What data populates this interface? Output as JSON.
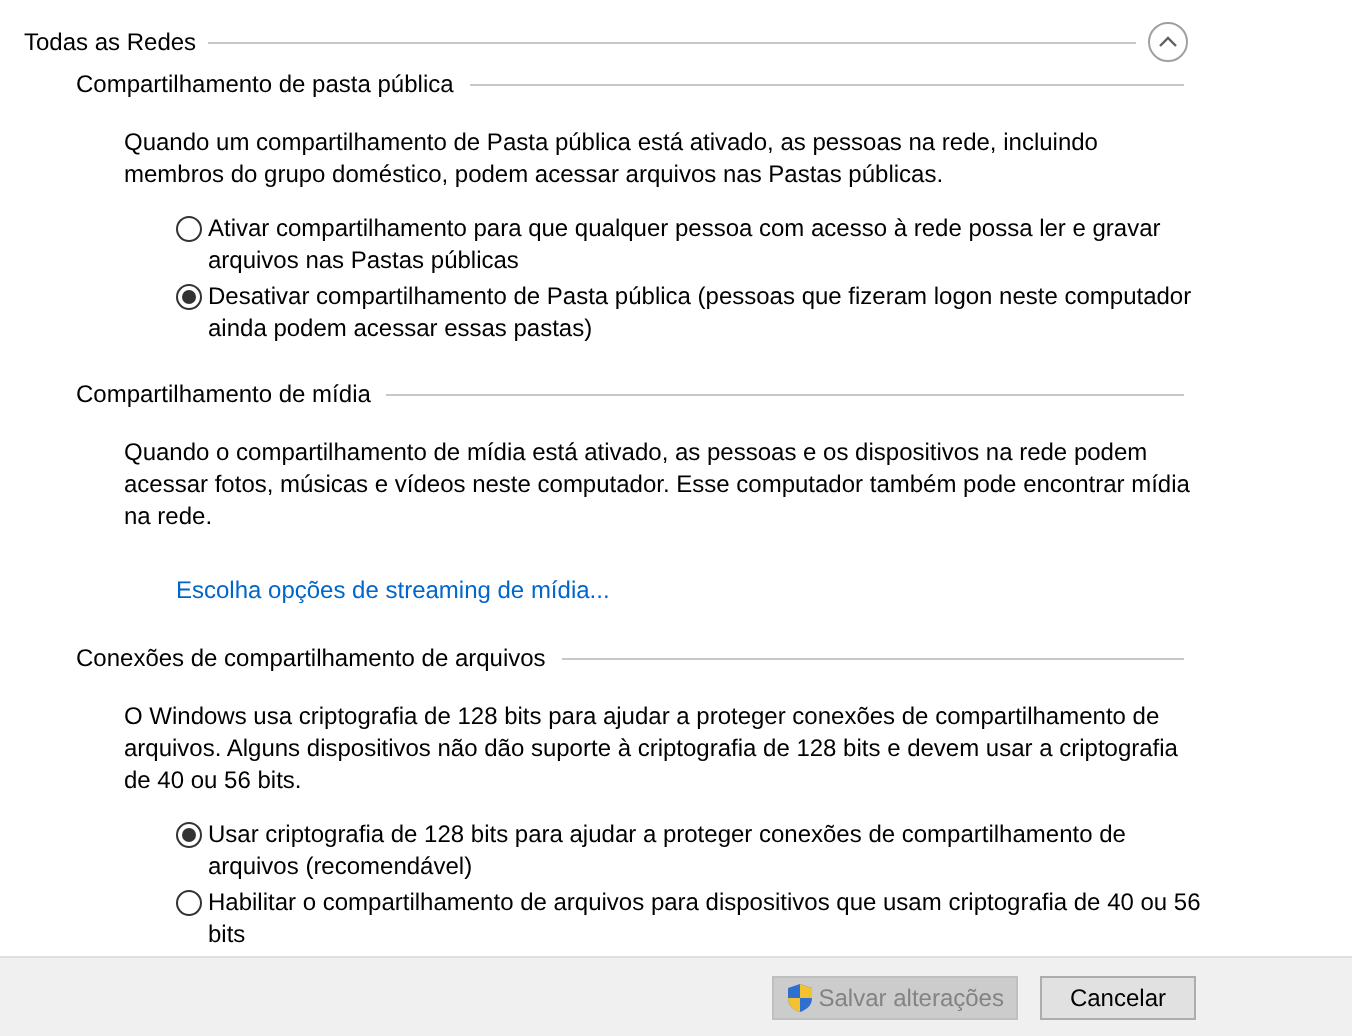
{
  "group": {
    "title": "Todas as Redes",
    "expanded": true
  },
  "sections": [
    {
      "heading": "Compartilhamento de pasta pública",
      "description": "Quando um compartilhamento de Pasta pública está ativado, as pessoas na rede, incluindo membros do grupo doméstico, podem acessar arquivos nas Pastas públicas.",
      "options": [
        {
          "label": "Ativar compartilhamento para que qualquer pessoa com acesso à rede possa ler e gravar arquivos nas Pastas públicas",
          "selected": false
        },
        {
          "label": "Desativar compartilhamento de Pasta pública (pessoas que fizeram logon neste computador ainda podem acessar essas pastas)",
          "selected": true
        }
      ]
    },
    {
      "heading": "Compartilhamento de mídia",
      "description": "Quando o compartilhamento de mídia está ativado, as pessoas e os dispositivos na rede podem acessar fotos, músicas e vídeos neste computador. Esse computador também pode encontrar mídia na rede.",
      "link": "Escolha opções de streaming de mídia..."
    },
    {
      "heading": "Conexões de compartilhamento de arquivos",
      "description": "O Windows usa criptografia de 128 bits para ajudar a proteger conexões de compartilhamento de arquivos. Alguns dispositivos não dão suporte à criptografia de 128 bits e devem usar a criptografia de 40 ou 56 bits.",
      "options": [
        {
          "label": "Usar criptografia de 128 bits para ajudar a proteger conexões de compartilhamento de arquivos (recomendável)",
          "selected": true
        },
        {
          "label": "Habilitar o compartilhamento de arquivos para dispositivos que usam criptografia de 40 ou 56 bits",
          "selected": false
        }
      ]
    }
  ],
  "buttons": [
    {
      "label": "Salvar alterações",
      "disabled": true,
      "shield": true
    },
    {
      "label": "Cancelar",
      "disabled": false,
      "shield": false
    }
  ]
}
